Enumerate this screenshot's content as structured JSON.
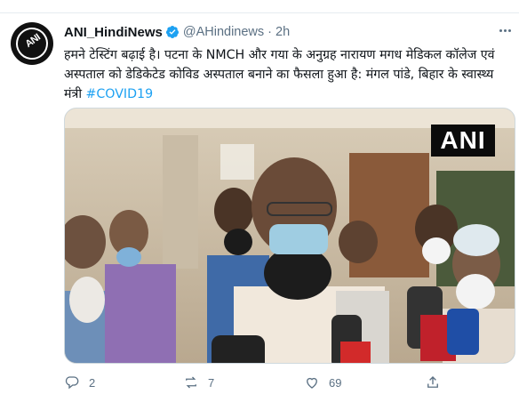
{
  "tweet": {
    "account": {
      "name": "ANI_HindiNews",
      "handle": "@AHindinews",
      "verified": true,
      "avatar_text": "ANI"
    },
    "separator": "·",
    "time": "2h",
    "text": "हमने टेस्टिंग बढ़ाई है। पटना के NMCH और गया के अनुग्रह नारायण मगध मेडिकल कॉलेज एवं अस्पताल को डेडिकेटेड कोविड अस्पताल बनाने का फैसला हुआ है: मंगल पांडे, बिहार के स्वास्थ्य मंत्री",
    "hashtag": "#COVID19",
    "media": {
      "watermark": "ANI"
    },
    "actions": {
      "reply_count": "2",
      "retweet_count": "7",
      "like_count": "69"
    }
  },
  "colors": {
    "accent": "#1da1f2",
    "secondary_text": "#5b7083",
    "border": "#cfd9de"
  },
  "icons": [
    "more-icon",
    "verified-icon",
    "reply-icon",
    "retweet-icon",
    "like-icon",
    "share-icon"
  ]
}
